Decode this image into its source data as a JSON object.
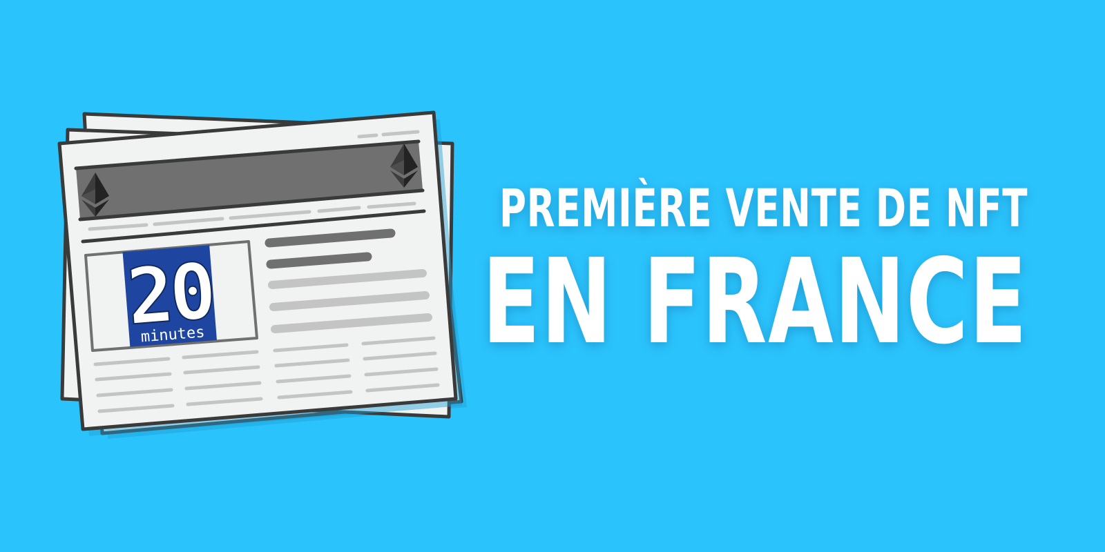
{
  "headline": {
    "line1": "PREMIÈRE VENTE DE NFT",
    "line2": "EN FRANCE"
  },
  "newspaper": {
    "logo_number": "20",
    "logo_word": "minutes",
    "logo_color": "#1e46a0",
    "emblem_icon": "ethereum-icon"
  },
  "colors": {
    "background": "#2bc3fc",
    "paper": "#f1f2f2",
    "header_bar": "#707070",
    "text_white": "#ffffff"
  }
}
